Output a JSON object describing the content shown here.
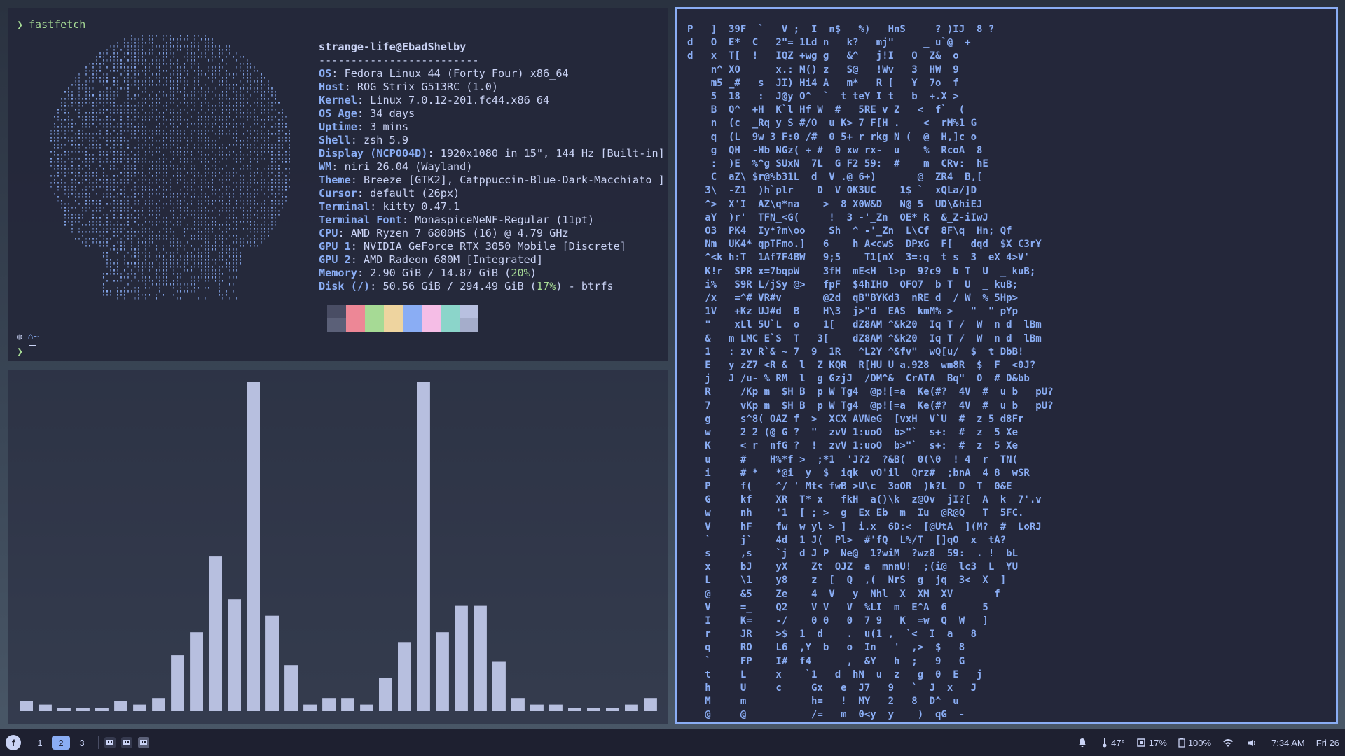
{
  "fetch": {
    "prompt": "❯",
    "command": "fastfetch",
    "title": "strange-life@EbadShelby",
    "separator": "-------------------------",
    "rows": [
      {
        "k": "OS",
        "v": ": Fedora Linux 44 (Forty Four) x86_64"
      },
      {
        "k": "Host",
        "v": ": ROG Strix G513RC (1.0)"
      },
      {
        "k": "Kernel",
        "v": ": Linux 7.0.12-201.fc44.x86_64"
      },
      {
        "k": "OS Age",
        "v": ": 34 days"
      },
      {
        "k": "Uptime",
        "v": ": 3 mins"
      },
      {
        "k": "Shell",
        "v": ": zsh 5.9"
      },
      {
        "k": "Display (NCP004D)",
        "v": ": 1920x1080 in 15\", 144 Hz [Built-in]"
      },
      {
        "k": "WM",
        "v": ": niri 26.04 (Wayland)"
      },
      {
        "k": "Theme",
        "v": ": Breeze [GTK2], Catppuccin-Blue-Dark-Macchiato ]"
      },
      {
        "k": "Cursor",
        "v": ": default (26px)"
      },
      {
        "k": "Terminal",
        "v": ": kitty 0.47.1"
      },
      {
        "k": "Terminal Font",
        "v": ": MonaspiceNeNF-Regular (11pt)"
      },
      {
        "k": "CPU",
        "v": ": AMD Ryzen 7 6800HS (16) @ 4.79 GHz"
      },
      {
        "k": "GPU 1",
        "v": ": NVIDIA GeForce RTX 3050 Mobile [Discrete]"
      },
      {
        "k": "GPU 2",
        "v": ": AMD Radeon 680M [Integrated]"
      },
      {
        "k": "Memory",
        "v": ": 2.90 GiB / 14.87 GiB (",
        "pct": "20%",
        "tail": ")"
      },
      {
        "k": "Disk (/)",
        "v": ": 50.56 GiB / 294.49 GiB (",
        "pct": "17%",
        "tail": ") - btrfs"
      }
    ],
    "cwd": "~",
    "palette_top": [
      "#494d64",
      "#ed8796",
      "#a6da95",
      "#eed49f",
      "#8aadf4",
      "#f5bde6",
      "#8bd5ca",
      "#b8c0e0"
    ],
    "palette_bottom": [
      "#5b6078",
      "#ed8796",
      "#a6da95",
      "#eed49f",
      "#8aadf4",
      "#f5bde6",
      "#8bd5ca",
      "#a5adcb"
    ]
  },
  "cava_levels": [
    0.03,
    0.02,
    0.01,
    0.01,
    0.01,
    0.03,
    0.02,
    0.04,
    0.17,
    0.24,
    0.47,
    0.34,
    1.0,
    0.29,
    0.14,
    0.02,
    0.04,
    0.04,
    0.02,
    0.1,
    0.21,
    1.0,
    0.24,
    0.32,
    0.32,
    0.15,
    0.04,
    0.02,
    0.02,
    0.01,
    0.005,
    0.005,
    0.02,
    0.04
  ],
  "matrix_lines": [
    "P   ]  39F  `   V ;  I  n$   %)   HnS     ? )IJ  8 ?",
    "d   O  E*  C   2\"= 1Ld n   k?   mj\"     _ u`@  +  ",
    "d   x  T[  !   IQZ +wg g   &^   j!I   O  Z&  o    ",
    "    n^ XO      x.: M() z   S@   !Wv   3  HW  9    ",
    "    m5 _#   s  JI) Hi4 A   m*   R [   Y  7o  f    ",
    "    5  18   :  J@y O^  `  t teY I t   b  +.X >    ",
    "    B  Q^  +H  K`l Hf W  #   5RE v Z   <  f`  (    ",
    "    n  (c  _Rq y S #/O  u K> 7 F[H .    <  rM%1 G    ",
    "    q  (L  9w 3 F:0 /#  0 5+ r rkg N (  @  H,]c o    ",
    "    g  QH  -Hb NGz( + #  0 xw rx-  u    %  RcoA  8   ",
    "    :  )E  %^g SUxN  7L  G F2 59:  #    m  CRv:  hE  ",
    "    C  aZ\\ $r@%b31L  d  V .@ 6+)       @  ZR4  B,[  ",
    "   3\\  -Z1  )h`plr    D  V OK3UC    1$ `  xQLa/]D   ",
    "   ^>  X'I  AZ\\q*na    >  8 X0W&D   N@ 5  UD\\&hiEJ   ",
    "   aY  )r'  TFN_<G(     !  3 -'_Zn  OE* R  &_Z-iIwJ  ",
    "   O3  PK4  Iy*?m\\oo    Sh  ^ -'_Zn  L\\Cf  8F\\q  Hn; Qf ",
    "   Nm  UK4* qpTFmo.]   6    h A<cwS  DPxG  F[   dqd  $X C3rY ",
    "   ^<k h:T  1Af7F4BW   9;5    T1[nX  3=:q  t s  3  eX 4>V'",
    "   K!r  SPR x=7bqpW    3fH  mE<H  l>p  9?c9  b T  U  _ kuB;",
    "   i%   S9R L/jSy @>   fpF  $4hIHO  OFO7  b T  U  _ kuB;",
    "   /x   =^# VR#v       @2d  qB\"BYKd3  nRE d  / W  % 5Hp>",
    "   1V   +Kz UJ#d  B    H\\3  j>\"d  EAS  kmM% >   \"  \" pYp",
    "   \"    xLl 5U`L  o    1[   dZ8AM ^&k20  Iq T /  W  n d  lBm",
    "   &   m LMC E`S  T   3[    dZ8AM ^&k20  Iq T /  W  n d  lBm",
    "   1   : zv R`& ~ 7  9  1R   ^L2Y ^&fv\"  wQ[u/  $  t DbB!",
    "   E   y zZ7 <R &  l  Z KQR  R[HU U a.928  wm8R  $  F  <0J?",
    "   j   J /u- % RM  l  g GzjJ  /DM^&  CrATA  Bq\"  O  # D&bb",
    "   R     /Kp m  $H B  p W Tg4  @p![=a  Ke(#?  4V  #  u b   pU?",
    "   7     vKp m  $H B  p W Tg4  @p![=a  Ke(#?  4V  #  u b   pU?",
    "   g     s^8( OAZ f  >  XCX AVNeG  [vxH  V`U  #  z 5 d8Fr",
    "   w     2 2 (@ G ?  \"  zvV 1:uoO  b>\"`  s+:  #  z  5 Xe",
    "   K     < r  nfG ?  !  zvV 1:uoO  b>\"`  s+:  #  z  5 Xe",
    "   u     #    H%*f >  ;*1  'J?2  ?&B(  0(\\0  ! 4  r  TN(",
    "   i     # *   *@i  y  $  iqk  vO'il  Qrz#  ;bnA  4 8  wSR",
    "   P     f(    ^/ ' Mt< fwB >U\\c  3oOR  )k?L  D  T  0&E",
    "   G     kf    XR  T* x   fkH  a()\\k  z@Ov  jI?[  A  k  7'.v",
    "   w     nh    '1  [ ; >  g  Ex Eb  m  Iu  @R@Q   T  5FC.",
    "   V     hF    fw  w yl > ]  i.x  6D:<  [@UtA  ](M?  #  LoRJ",
    "   `     j`    4d  1 J(  Pl>  #'fQ  L%/T  []qO  x  tA?",
    "   s     ,s    `j  d J P  Ne@  1?wiM  ?wz8  59:  . !  bL",
    "   x     bJ    yX    Zt  QJZ  a  mnnU!  ;(i@  lc3  L  YU",
    "   L     \\1    y8    z  [  Q  ,(  NrS  g  jq  3<  X  ]",
    "   @     &5    Ze    4  V   y  Nhl  X  XM  XV       f",
    "   V     =_    Q2    V V   V  %LI  m  E^A  6      5",
    "   I     K=    -/    0 0   0  7 9   K  =w  Q  W   ]",
    "   r     JR    >$  1  d    .  u(1 ,  `<  I  a   8",
    "   q     RO    L6  ,Y  b   o  In   '  ,>  $   8",
    "   `     FP    I#  f4      ,  &Y   h  ;   9   G",
    "   t     L     x    `1   d  hN  u  z   g  0  E   j",
    "   h     U     c     Gx   e  J7   9   `  J  x   J",
    "   M     m           h=   !  MY   2   8  D^  u",
    "   @     @           /=   m  0<y  y    )  qG  -"
  ],
  "taskbar": {
    "workspaces": [
      "1",
      "2",
      "3"
    ],
    "active_workspace": "2",
    "temp": "47°",
    "cpu": "17%",
    "battery": "100%",
    "time": "7:34 AM",
    "date": "Fri 26"
  }
}
